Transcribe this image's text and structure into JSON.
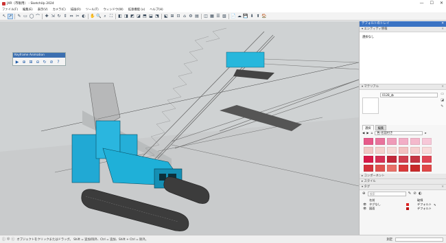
{
  "window": {
    "title": "JXR（市販用） - SketchUp 2024",
    "controls": [
      "—",
      "☐",
      "✕"
    ]
  },
  "menu": [
    "ファイル(F)",
    "編集(E)",
    "表示(V)",
    "カメラ(C)",
    "描画(R)",
    "ツール(T)",
    "ウィンドウ(W)",
    "拡張機能 (x)",
    "ヘルプ(H)"
  ],
  "toolbar": {
    "icons": [
      "↖",
      "➚",
      "✎",
      "▭",
      "◯",
      "⌒",
      "✚",
      "⇲",
      "↻",
      "⇕",
      "⇔",
      "✂",
      "◐",
      "✋",
      "🔍",
      "⌕",
      "⛶",
      "◧",
      "◨",
      "◩",
      "◪",
      "⬒",
      "⬓",
      "⬔",
      "⬕",
      "⊞",
      "⊡",
      "⌂",
      "⚙",
      "▤",
      "◫",
      "▦",
      "☰",
      "▧",
      "◰",
      "◱",
      "📄",
      "☁",
      "💾",
      "⬇",
      "⬆",
      "🏠"
    ]
  },
  "keyframe": {
    "title": "Keyframe Animation",
    "buttons": [
      "▶",
      "⊕",
      "⊞",
      "⊖",
      "↻",
      "⊘",
      "?"
    ]
  },
  "panel": {
    "title": "デフォルトのトレイ",
    "entity": {
      "header": "エンティティ情報",
      "text": "選択なし"
    },
    "materials": {
      "header": "マテリアル",
      "name": "0128_赤",
      "tabs": [
        "選択",
        "編集"
      ],
      "library": "色-名前付き",
      "swatches": [
        "#e65a8a",
        "#e8739c",
        "#ef9bb8",
        "#f2aec6",
        "#f4b9cc",
        "#f7c8d8",
        "#f1c6c4",
        "#f4d0cd",
        "#f6dad7",
        "#f3c1c1",
        "#f6cfcf",
        "#f9dada",
        "#d81a48",
        "#d53055",
        "#c2283a",
        "#d04050",
        "#c43543",
        "#e04555",
        "#d4323c",
        "#e0524f",
        "#e87068",
        "#d93a3a",
        "#c82a2a",
        "#e04848"
      ]
    },
    "components": "コンポーネント",
    "styles": "スタイル",
    "tags": {
      "header": "タグ",
      "search_placeholder": "検索",
      "columns": [
        "名前",
        "破線"
      ],
      "rows": [
        {
          "name": "タグなし",
          "color": "#d22",
          "dash": "デフォルト"
        },
        {
          "name": "図面",
          "color": "#b11",
          "dash": "デフォルト"
        }
      ]
    }
  },
  "status": {
    "icons": [
      "ⓘ",
      "◎",
      "ⓒ"
    ],
    "text": "オブジェクトをクリックまたはドラッグ。 Shift = 追加/除外、Ctrl = 追加、Shift + Ctrl = 除外。",
    "measurement_label": "測定"
  }
}
